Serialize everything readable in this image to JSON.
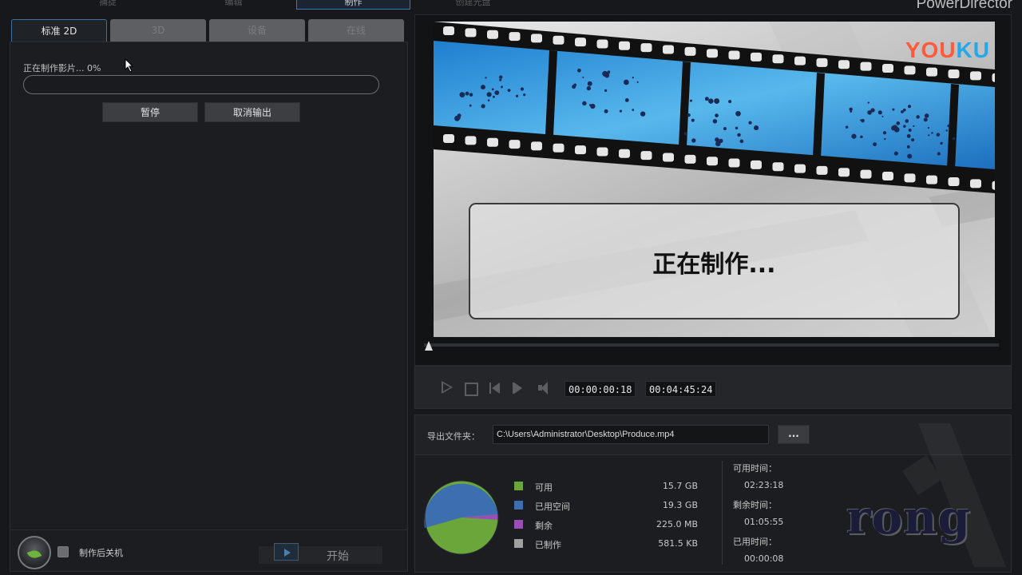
{
  "app": {
    "title": "PowerDirector"
  },
  "nav": {
    "items": [
      "捕捉",
      "编辑",
      "制作",
      "创建光盘"
    ],
    "active": "制作"
  },
  "tabs": [
    "标准 2D",
    "3D",
    "设备",
    "在线"
  ],
  "progress": {
    "status": "正在制作影片... 0%",
    "percent": 0
  },
  "buttons": {
    "pause": "暂停",
    "cancel": "取消输出",
    "start": "开始",
    "browse": "..."
  },
  "shutdown": {
    "label": "制作后关机",
    "checked": false
  },
  "preview": {
    "watermark_a": "YOU",
    "watermark_b": "KU",
    "overlay": "正在制作..."
  },
  "player": {
    "current_time": "00:00:00:18",
    "total_time": "00:04:45:24"
  },
  "export": {
    "folder_label": "导出文件夹：",
    "path": "C:\\Users\\Administrator\\Desktop\\Produce.mp4"
  },
  "disk": {
    "items": [
      {
        "label": "可用",
        "value": "15.7  GB",
        "color": "#6aa63a"
      },
      {
        "label": "已用空间",
        "value": "19.3  GB",
        "color": "#3d6fb0"
      },
      {
        "label": "剩余",
        "value": "225.0  MB",
        "color": "#9a4fb8"
      },
      {
        "label": "已制作",
        "value": "581.5  KB",
        "color": "#a0a0a0"
      }
    ]
  },
  "times": {
    "available_label": "可用时间：",
    "available": "02:23:18",
    "remaining_label": "剩余时间：",
    "remaining": "01:05:55",
    "produced_label": "已用时间：",
    "produced": "00:00:08"
  },
  "overlay_caption": "rong"
}
